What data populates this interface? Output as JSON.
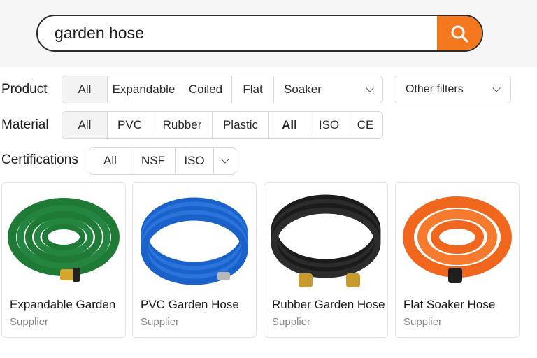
{
  "search": {
    "value": "garden hose",
    "icon": "search-icon",
    "button_color": "#f5781e"
  },
  "filters": {
    "product": {
      "label": "Product",
      "options": [
        "All",
        "Expandable",
        "Coiled",
        "Flat",
        "Soaker"
      ],
      "active": "All"
    },
    "other_filters": {
      "label": "Other filters"
    },
    "material": {
      "label": "Material",
      "options": [
        "All",
        "PVC",
        "Rubber",
        "Plastic",
        "All",
        "ISO",
        "CE"
      ],
      "active": "All"
    },
    "certifications": {
      "label": "Certifications",
      "options": [
        "All",
        "NSF",
        "ISO"
      ]
    }
  },
  "products": [
    {
      "title": "Expandable Garden",
      "supplier": "Supplier",
      "hose_color": "#1f7a36"
    },
    {
      "title": "PVC Garden Hose",
      "supplier": "Supplier",
      "hose_color": "#1a62c9"
    },
    {
      "title": "Rubber Garden Hose",
      "supplier": "Supplier",
      "hose_color": "#1b1b1b"
    },
    {
      "title": "Flat Soaker Hose",
      "supplier": "Supplier",
      "hose_color": "#f0661c"
    }
  ]
}
